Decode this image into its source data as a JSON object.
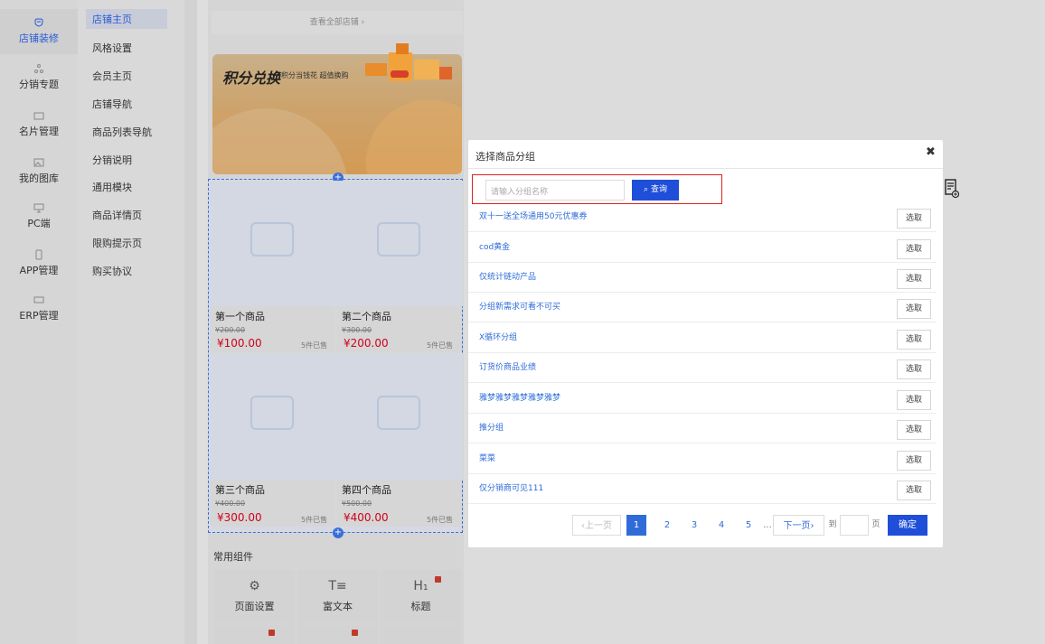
{
  "sidebar": {
    "items": [
      {
        "label": "店铺装修",
        "icon": "shop-decor-icon"
      },
      {
        "label": "分销专题",
        "icon": "distribution-icon"
      },
      {
        "label": "名片管理",
        "icon": "card-icon"
      },
      {
        "label": "我的图库",
        "icon": "image-library-icon"
      },
      {
        "label": "PC端",
        "icon": "pc-icon"
      },
      {
        "label": "APP管理",
        "icon": "app-icon"
      },
      {
        "label": "ERP管理",
        "icon": "erp-icon"
      }
    ]
  },
  "subnav": {
    "items": [
      "店铺主页",
      "风格设置",
      "会员主页",
      "店铺导航",
      "商品列表导航",
      "分销说明",
      "通用模块",
      "商品详情页",
      "限购提示页",
      "购买协议"
    ]
  },
  "preview": {
    "view_all": "查看全部店铺 ›",
    "banner_title": "积分兑换",
    "banner_sub": "积分当钱花 超值换购",
    "products": [
      {
        "name": "第一个商品",
        "old": "¥200.00",
        "price": "¥100.00",
        "sold": "5件已售"
      },
      {
        "name": "第二个商品",
        "old": "¥300.00",
        "price": "¥200.00",
        "sold": "5件已售"
      },
      {
        "name": "第三个商品",
        "old": "¥400.00",
        "price": "¥300.00",
        "sold": "5件已售"
      },
      {
        "name": "第四个商品",
        "old": "¥500.00",
        "price": "¥400.00",
        "sold": "5件已售"
      }
    ],
    "common_title": "常用组件",
    "components": [
      {
        "label": "页面设置",
        "icon": "settings-gear-icon",
        "glyph": "⚙"
      },
      {
        "label": "富文本",
        "icon": "rich-text-icon",
        "glyph": "T≡"
      },
      {
        "label": "标题",
        "icon": "heading-icon",
        "glyph": "H₁"
      }
    ]
  },
  "modal": {
    "title": "选择商品分组",
    "close": "✖",
    "search_placeholder": "请输入分组名称",
    "search_button": "查询",
    "select_label": "选取",
    "groups": [
      "双十一送全场通用50元优惠券",
      "cod黄金",
      "仅统计链动产品",
      "分组新需求可看不可买",
      "X循环分组",
      "订货价商品业绩",
      "雅梦雅梦雅梦雅梦雅梦",
      "推分组",
      "菜菜",
      "仅分销商可见111"
    ],
    "pagination": {
      "prev": "‹上一页",
      "pages": [
        "1",
        "2",
        "3",
        "4",
        "5"
      ],
      "ellipsis": "...",
      "current": "1",
      "next": "下一页›",
      "to": "到",
      "page_unit": "页",
      "confirm": "确定"
    }
  },
  "colors": {
    "accent": "#1f4ed8",
    "link": "#2f6cd8",
    "price": "#d0021b",
    "highlight": "#e02020"
  }
}
